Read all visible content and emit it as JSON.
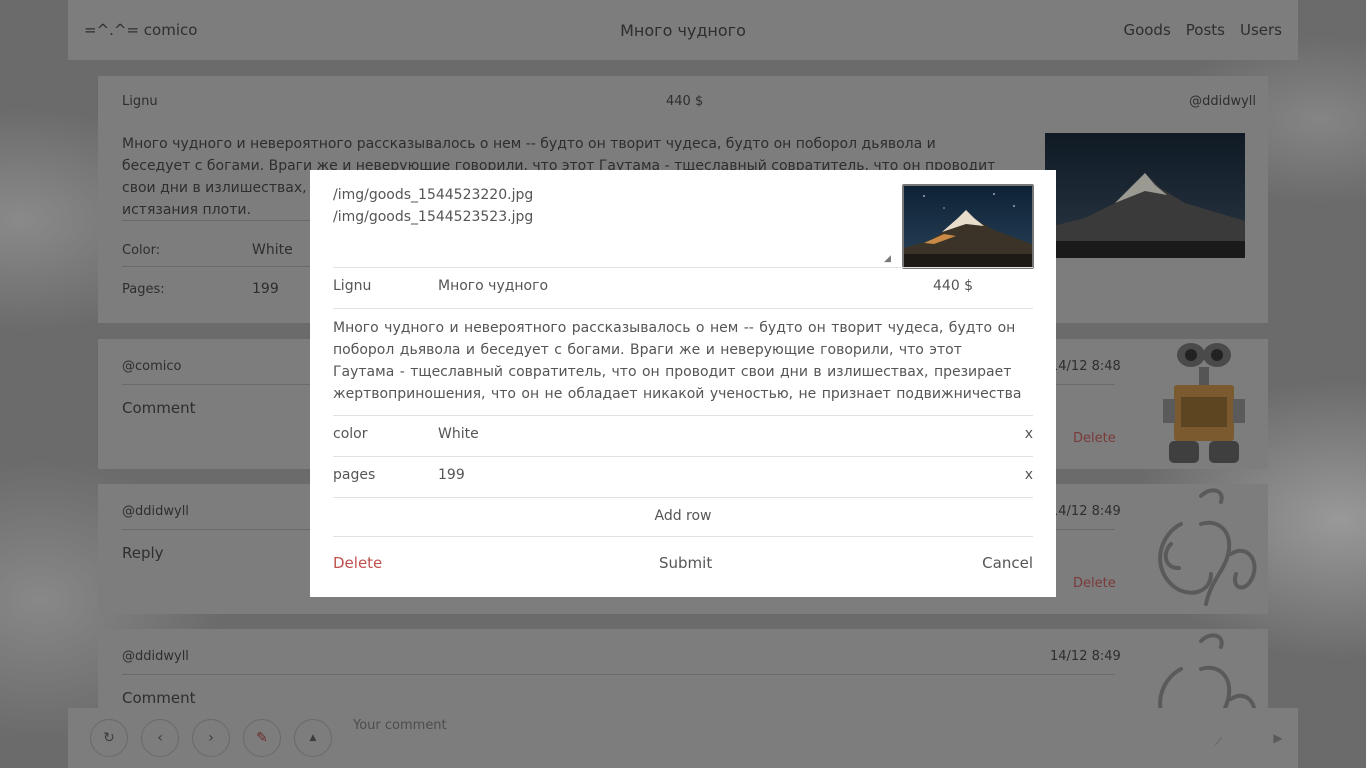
{
  "topbar": {
    "brand": "=^.^= comico",
    "title": "Много чудного",
    "nav": [
      "Goods",
      "Posts",
      "Users"
    ]
  },
  "goods_card": {
    "owner": "Lignu",
    "price": "440 $",
    "user": "@ddidwyll",
    "description": "Много чудного и невероятного рассказывалось о нем -- будто он творит чудеса, будто он поборол дьявола и беседует с богами. Враги же и неверующие говорили, что этот Гаутама - тщеславный совратитель, что он проводит свои дни в излишествах, презирает ж",
    "description_tail": "истязания плоти.",
    "props": [
      {
        "key": "Color:",
        "value": "White"
      },
      {
        "key": "Pages:",
        "value": "199"
      }
    ]
  },
  "comments": [
    {
      "user": "@comico",
      "date": "14/12 8:48",
      "text": "Comment",
      "delete": "Delete",
      "avatar": "robot-avatar"
    },
    {
      "user": "@ddidwyll",
      "date": "14/12 8:49",
      "text": "Reply",
      "delete": "Delete",
      "avatar": "ganesha-avatar"
    },
    {
      "user": "@ddidwyll",
      "date": "14/12 8:49",
      "text": "Comment",
      "avatar": "ganesha-avatar"
    }
  ],
  "bottombar": {
    "buttons": [
      "refresh-icon",
      "chevron-left-icon",
      "chevron-right-icon",
      "pencil-icon",
      "arrow-up-icon"
    ],
    "placeholder": "Your comment",
    "send": "▶"
  },
  "modal": {
    "files": "/img/goods_1544523220.jpg\n/img/goods_1544523523.jpg",
    "owner": "Lignu",
    "name": "Много чудного",
    "price": "440 $",
    "description": "Много чудного и невероятного  рассказывалось  о нем -- будто он творит  чудеса, будто он поборол дьявола и беседует с богами. Враги же  и неверующие  говорили,  что   этот  Гаутама - тщеславный  совратитель,  что  он проводит  свои  дни в  излишествах, презирает жертвоприношения,  что  он  не обладает никакой ученостью, не признает подвижничества и",
    "rows": [
      {
        "key": "color",
        "value": "White",
        "remove": "x"
      },
      {
        "key": "pages",
        "value": "199",
        "remove": "x"
      }
    ],
    "add_row": "Add row",
    "delete": "Delete",
    "submit": "Submit",
    "cancel": "Cancel"
  },
  "colors": {
    "danger": "#c0504d",
    "overlay": "#6b6b6b"
  }
}
